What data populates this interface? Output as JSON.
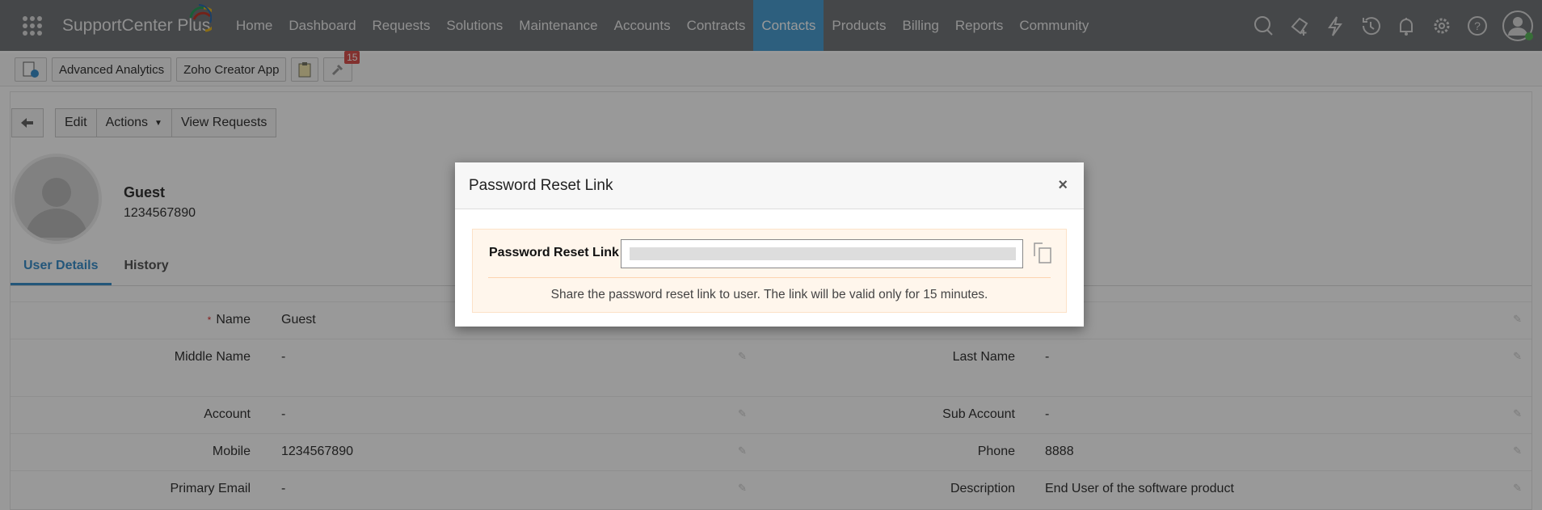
{
  "app": {
    "name": "SupportCenter Plus"
  },
  "nav": {
    "tabs": [
      "Home",
      "Dashboard",
      "Requests",
      "Solutions",
      "Maintenance",
      "Accounts",
      "Contracts",
      "Contacts",
      "Products",
      "Billing",
      "Reports",
      "Community"
    ],
    "active": "Contacts",
    "icons": [
      "search-icon",
      "add-ticket-icon",
      "lightning-icon",
      "history-icon",
      "bell-icon",
      "gear-icon",
      "help-icon",
      "user-avatar-icon"
    ]
  },
  "toolbar": {
    "advanced_analytics": "Advanced Analytics",
    "zoho_creator": "Zoho Creator App",
    "badge_count": "15"
  },
  "actions": {
    "edit": "Edit",
    "actions": "Actions",
    "view_requests": "View Requests"
  },
  "user": {
    "name": "Guest",
    "phone": "1234567890"
  },
  "user_tabs": [
    "User Details",
    "History"
  ],
  "fields": {
    "name_label": "Name",
    "name_value": "Guest",
    "middle_label": "Middle Name",
    "middle_value": "-",
    "last_label": "Last Name",
    "last_value": "-",
    "account_label": "Account",
    "account_value": "-",
    "subaccount_label": "Sub Account",
    "subaccount_value": "-",
    "mobile_label": "Mobile",
    "mobile_value": "1234567890",
    "phone_label": "Phone",
    "phone_value": "8888",
    "email_label": "Primary Email",
    "email_value": "-",
    "desc_label": "Description",
    "desc_value": "End User of the software product"
  },
  "modal": {
    "title": "Password Reset Link",
    "close": "×",
    "field_label": "Password Reset Link",
    "note": "Share the password reset link to user. The link will be valid only for 15 minutes."
  }
}
